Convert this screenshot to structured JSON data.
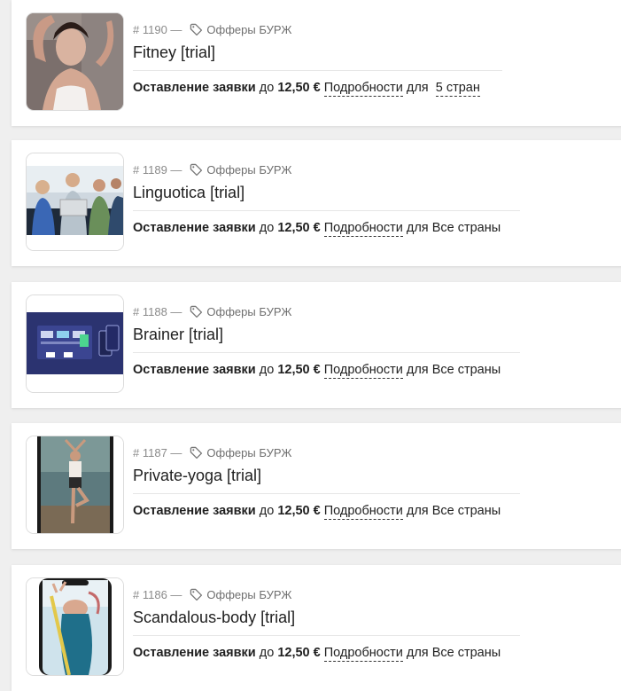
{
  "offers": [
    {
      "number": "# 1190 —",
      "tag": "Офферы БУРЖ",
      "title": "Fitney [trial]",
      "action": "Оставление заявки",
      "upto": "до",
      "price": "12,50 €",
      "details": "Подробности",
      "for": "для",
      "geo": "5 стран",
      "geo_is_link": true
    },
    {
      "number": "# 1189 —",
      "tag": "Офферы БУРЖ",
      "title": "Linguotica [trial]",
      "action": "Оставление заявки",
      "upto": "до",
      "price": "12,50 €",
      "details": "Подробности",
      "for": "для",
      "geo": "Все страны",
      "geo_is_link": false
    },
    {
      "number": "# 1188 —",
      "tag": "Офферы БУРЖ",
      "title": "Brainer [trial]",
      "action": "Оставление заявки",
      "upto": "до",
      "price": "12,50 €",
      "details": "Подробности",
      "for": "для",
      "geo": "Все страны",
      "geo_is_link": false
    },
    {
      "number": "# 1187 —",
      "tag": "Офферы БУРЖ",
      "title": "Private-yoga [trial]",
      "action": "Оставление заявки",
      "upto": "до",
      "price": "12,50 €",
      "details": "Подробности",
      "for": "для",
      "geo": "Все страны",
      "geo_is_link": false
    },
    {
      "number": "# 1186 —",
      "tag": "Офферы БУРЖ",
      "title": "Scandalous-body [trial]",
      "action": "Оставление заявки",
      "upto": "до",
      "price": "12,50 €",
      "details": "Подробности",
      "for": "для",
      "geo": "Все страны",
      "geo_is_link": false
    }
  ]
}
